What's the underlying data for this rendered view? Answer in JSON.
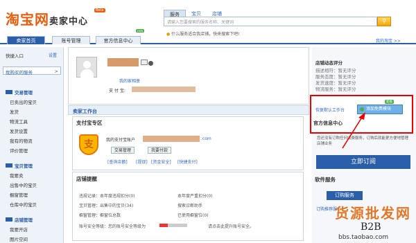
{
  "header": {
    "logo_main": "淘宝网",
    "logo_sub": "卖家中心",
    "beta": "Beta",
    "search_tabs": [
      "服务",
      "宝贝",
      "店铺"
    ],
    "search_placeholder": "请输入您要搜索的服务名称、关键词",
    "search_icon": "search-icon",
    "tip": "什么服务适合我店铺，快来搜索下吧!"
  },
  "nav": {
    "tabs": [
      "卖家首页",
      "账号管理",
      "官方信息中心"
    ],
    "new_badge": "new",
    "my_shop": "我的淘宝 >>"
  },
  "sidebar": {
    "quick": "快捷入口",
    "settings": "设置",
    "bought": "我购买的服务",
    "groups": [
      {
        "title": "交易管理",
        "items": [
          "已卖出的宝贝",
          "发货",
          "物流工具",
          "发货设置",
          "我有的物流",
          "评价管理"
        ]
      },
      {
        "title": "宝贝管理",
        "items": [
          "我要卖",
          "出售中的宝贝",
          "橱窗管理",
          "仓库中的宝贝"
        ]
      },
      {
        "title": "店铺管理",
        "items": [
          "我要开店",
          "图片空间"
        ]
      }
    ]
  },
  "profile": {
    "my_pic": "我的家相册",
    "alipay_label": "支 付 宝:"
  },
  "workbench": {
    "title": "卖家工作台",
    "alipay_title": "支付宝专区",
    "alipay_account": "我的支付宝账户",
    "com": ".com",
    "trade_btn": "交易管理",
    "pay_btn": "我要付款",
    "links": [
      "[查询余额]",
      "[提现]",
      "[资金安全]",
      "[快捷支付]"
    ]
  },
  "shop": {
    "title": "店铺提醒",
    "rows": [
      [
        "违规记录：本年度违规扣分(0)",
        "本年度严重扣分(0)"
      ],
      [
        "宝贝管理：出售中的宝贝(34)",
        "搜索诊断助手"
      ],
      [
        "橱窗管理：橱窗位总数",
        "已使用橱窗位(0)"
      ],
      [
        "账号安全等级：您的账号安全等级为",
        "请点击此提升账号安全。"
      ]
    ]
  },
  "right": {
    "dsr_title": "店铺动态评分",
    "dsr_rows": [
      "描述相符：暂无评分",
      "服务态度：暂无评分",
      "发货速度：暂无评分",
      "物流服务：暂无评分"
    ],
    "popup_restore": "恢复默认工作台",
    "popup_btn": "添加免费模块",
    "popup_new": "新版",
    "popup_center": "官方信息中心",
    "desc": "您还没有订购任何收费服务，订购后就能更方便地管理店铺业务",
    "order_btn": "立即订阅",
    "svc_head": "软件服务",
    "svc_btn": "订购服务",
    "svc_small": "订购推荐服务"
  },
  "watermark": {
    "line1": "货源批发网",
    "line2": "B2B",
    "line3": "bbs.taobao.com"
  },
  "colors": {
    "brand": "#e85d0d",
    "nav": "#2a5ea8",
    "highlight": "#e00000"
  }
}
